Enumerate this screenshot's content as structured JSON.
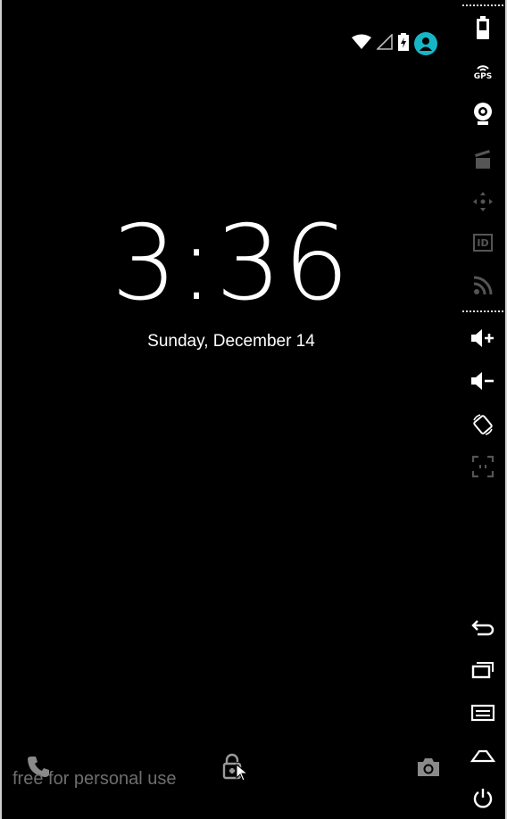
{
  "lockscreen": {
    "time": "3:36",
    "date": "Sunday, December 14",
    "watermark": "free for personal use"
  },
  "status_bar": {
    "icons": [
      "wifi-icon",
      "cellular-signal-icon",
      "battery-charging-icon",
      "user-avatar-icon"
    ],
    "avatar_color": "#17b6c6"
  },
  "bottom_actions": [
    "phone-icon",
    "unlock-icon",
    "camera-icon"
  ],
  "side_toolbar": {
    "top_tools": [
      "battery-icon",
      "gps-icon",
      "webcam-icon",
      "clapperboard-icon",
      "move-icon",
      "id-card-icon",
      "rss-icon"
    ],
    "gps_label": "GPS",
    "id_label": "ID",
    "mid_tools": [
      "volume-up-icon",
      "volume-down-icon",
      "rotate-icon",
      "fullscreen-icon"
    ],
    "nav_tools": [
      "back-icon",
      "recents-icon",
      "menu-icon",
      "home-icon",
      "power-icon"
    ]
  }
}
